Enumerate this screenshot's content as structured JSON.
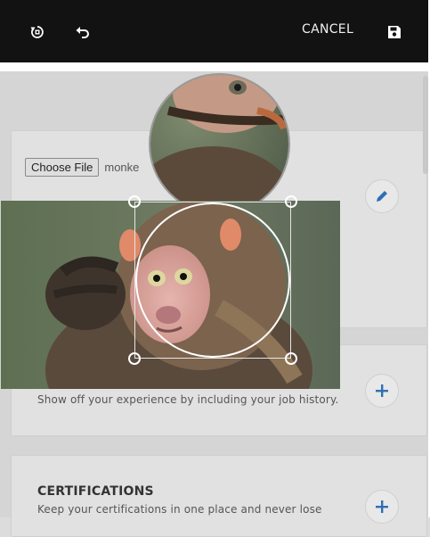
{
  "toolbar": {
    "rotate_icon": "rotate-icon",
    "undo_icon": "undo-icon",
    "cancel_label": "CANCEL",
    "save_icon": "save-icon"
  },
  "upload": {
    "choose_label": "Choose File",
    "file_name": "monke"
  },
  "experience": {
    "description": "Show off your experience by including your job history."
  },
  "certifications": {
    "title": "CERTIFICATIONS",
    "description": "Keep your certifications in one place and never lose"
  },
  "colors": {
    "toolbar_bg": "#121212",
    "accent": "#2f6fb4",
    "page_bg": "#d5d5d5"
  }
}
